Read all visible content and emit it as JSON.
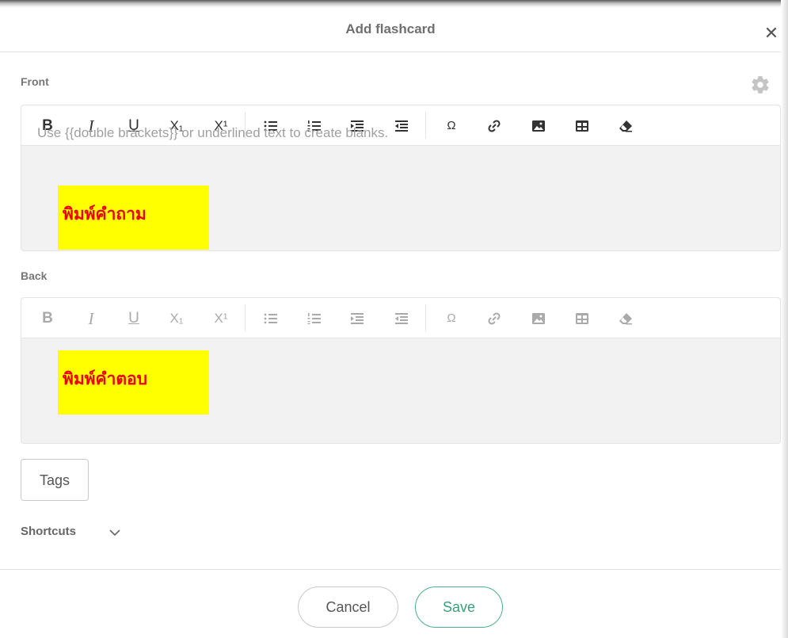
{
  "dialog": {
    "title": "Add flashcard",
    "close_icon": "close-icon"
  },
  "front": {
    "label": "Front",
    "placeholder": "Use {{double brackets}} or underlined text to create blanks.",
    "overlay_text": "พิมพ์คำถาม"
  },
  "back": {
    "label": "Back",
    "overlay_text": "พิมพ์คำตอบ"
  },
  "toolbar": {
    "bold": "B",
    "italic": "I",
    "underline": "U",
    "subscript": "X₁",
    "superscript": "X¹",
    "special_char": "Ω"
  },
  "tags_label": "Tags",
  "shortcuts_label": "Shortcuts",
  "buttons": {
    "cancel": "Cancel",
    "save": "Save"
  },
  "colors": {
    "accent": "#4caf87",
    "highlight": "#ffff00",
    "overlay_text": "#e8000e"
  }
}
